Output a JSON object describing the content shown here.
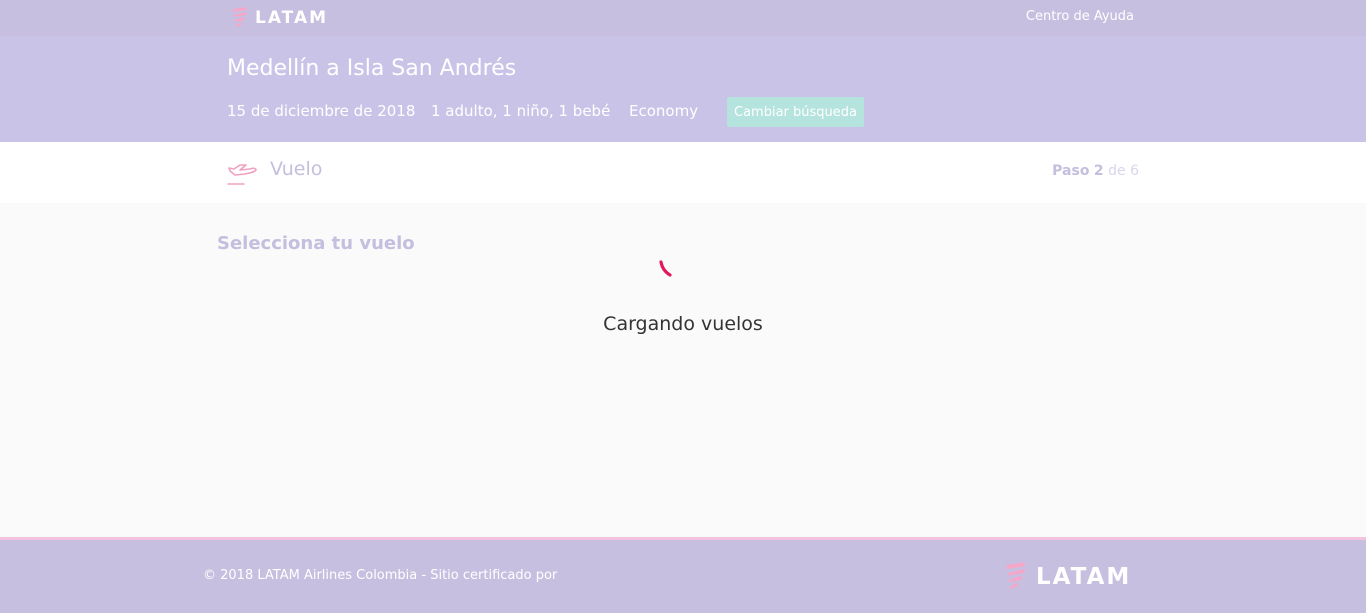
{
  "header": {
    "logo_text": "LATAM",
    "help_link": "Centro de Ayuda"
  },
  "search": {
    "route": "Medellín a Isla San Andrés",
    "date": "15 de diciembre de 2018",
    "passengers": "1 adulto, 1 niño, 1 bebé",
    "cabin": "Economy",
    "change_button": "Cambiar búsqueda"
  },
  "step": {
    "icon": "plane-takeoff-icon",
    "label": "Vuelo",
    "paso_word": "Paso",
    "current": "2",
    "of_word": "de",
    "total": "6"
  },
  "main": {
    "section_title": "Selecciona tu vuelo",
    "loading_text": "Cargando vuelos",
    "spinner_icon": "loading-spinner-icon"
  },
  "footer": {
    "copyright": "© 2018 LATAM Airlines Colombia - Sitio certificado por",
    "logo_text": "LATAM"
  },
  "colors": {
    "header_bg": "#c7bfe0",
    "summary_bg": "#c9c4e7",
    "accent_pink": "#e0195f",
    "button_bg": "#b5e3dd",
    "step_text": "#c4bedf"
  }
}
